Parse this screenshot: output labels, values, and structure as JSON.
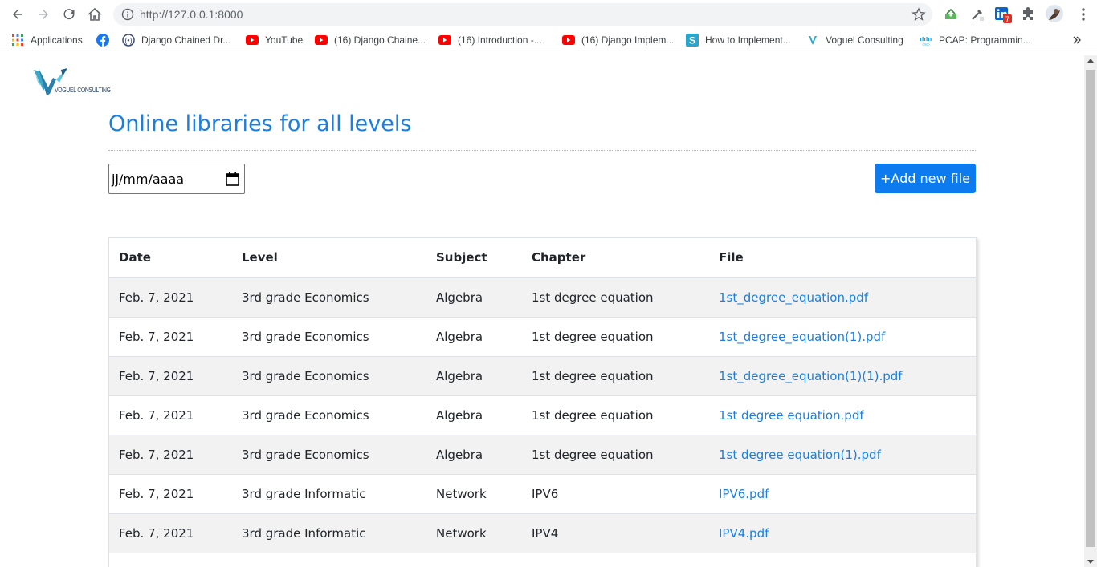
{
  "browser": {
    "url": "http://127.0.0.1:8000",
    "linkedin_badge": "7"
  },
  "bookmarks": [
    {
      "label": "Applications",
      "icon": "apps-grid-icon"
    },
    {
      "label": "",
      "icon": "facebook-icon"
    },
    {
      "label": "Django Chained Dr...",
      "icon": "site-icon"
    },
    {
      "label": "YouTube",
      "icon": "youtube-icon"
    },
    {
      "label": "(16) Django Chaine...",
      "icon": "youtube-icon"
    },
    {
      "label": "(16) Introduction -...",
      "icon": "youtube-icon"
    },
    {
      "label": "(16) Django Implem...",
      "icon": "youtube-icon"
    },
    {
      "label": "How to Implement...",
      "icon": "s-icon"
    },
    {
      "label": "Voguel Consulting",
      "icon": "v-icon"
    },
    {
      "label": "PCAP: Programmin...",
      "icon": "cisco-icon"
    }
  ],
  "logo_text": "VOGUEL CONSULTING",
  "page_title": "Online libraries for all levels",
  "date_input": {
    "placeholder": "jj/mm/aaaa"
  },
  "add_button": "+Add new file",
  "table": {
    "headers": [
      "Date",
      "Level",
      "Subject",
      "Chapter",
      "File"
    ],
    "rows": [
      [
        "Feb. 7, 2021",
        "3rd grade Economics",
        "Algebra",
        "1st degree equation",
        "1st_degree_equation.pdf"
      ],
      [
        "Feb. 7, 2021",
        "3rd grade Economics",
        "Algebra",
        "1st degree equation",
        "1st_degree_equation(1).pdf"
      ],
      [
        "Feb. 7, 2021",
        "3rd grade Economics",
        "Algebra",
        "1st degree equation",
        "1st_degree_equation(1)(1).pdf"
      ],
      [
        "Feb. 7, 2021",
        "3rd grade Economics",
        "Algebra",
        "1st degree equation",
        "1st degree equation.pdf"
      ],
      [
        "Feb. 7, 2021",
        "3rd grade Economics",
        "Algebra",
        "1st degree equation",
        "1st degree equation(1).pdf"
      ],
      [
        "Feb. 7, 2021",
        "3rd grade Informatic",
        "Network",
        "IPV6",
        "IPV6.pdf"
      ],
      [
        "Feb. 7, 2021",
        "3rd grade Informatic",
        "Network",
        "IPV4",
        "IPV4.pdf"
      ],
      [
        "",
        "",
        "",
        "",
        ""
      ]
    ]
  },
  "colors": {
    "accent": "#1a7fe0",
    "button": "#0d7bf0",
    "row_stripe": "#f2f2f2"
  }
}
